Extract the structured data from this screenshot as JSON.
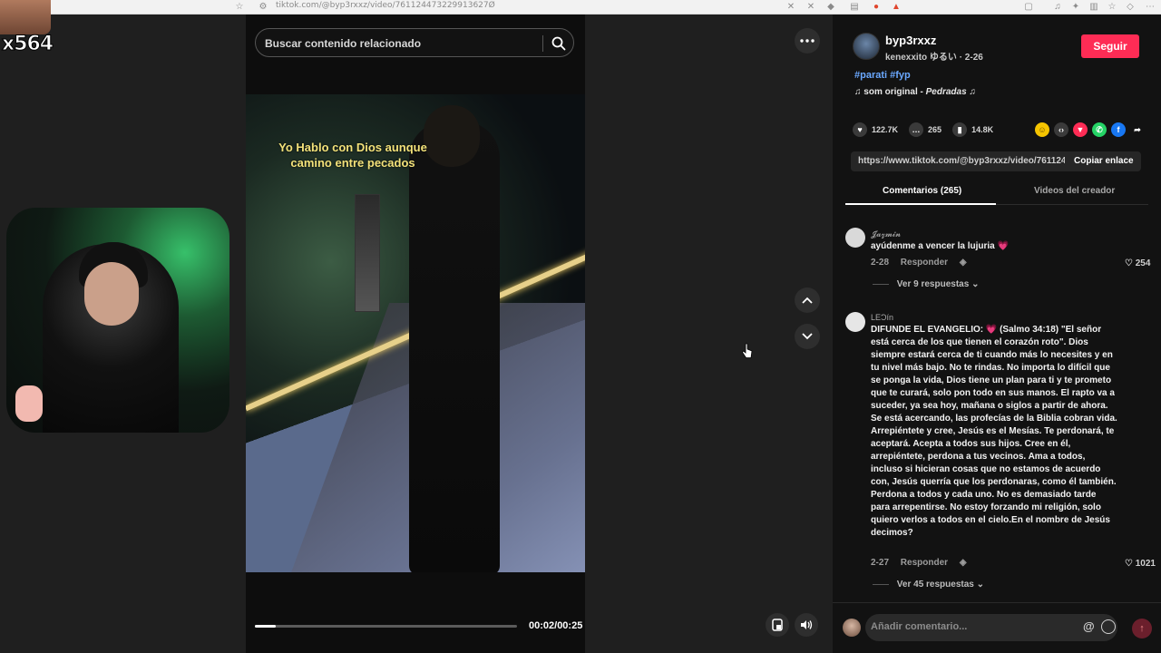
{
  "browser": {
    "url": "tiktok.com/@byp3rxxz/video/761124473229913627Ø"
  },
  "overlay": {
    "streamer_tag": "x564"
  },
  "video": {
    "search_placeholder": "Buscar contenido relacionado",
    "caption": "Yo Hablo con Dios aunque camino entre pecados",
    "time": "00:02/00:25",
    "progress": 0.08
  },
  "author": {
    "username": "byp3rxxz",
    "subtitle": "kenexxito ゆるい · 2-26",
    "follow_label": "Seguir",
    "hashtags": "#parati #fyp",
    "sound_prefix": "som original - ",
    "sound_name": "Pedradas"
  },
  "stats": {
    "likes": "122.7K",
    "comments": "265",
    "saves": "14.8K"
  },
  "share": {
    "link": "https://www.tiktok.com/@byp3rxxz/video/7611244...",
    "copy_label": "Copiar enlace"
  },
  "tabs": [
    {
      "label": "Comentarios (265)",
      "active": true
    },
    {
      "label": "Videos del creador",
      "active": false
    }
  ],
  "comments": [
    {
      "user": "𝓙𝓪𝔃𝓶𝓲𝓷",
      "text": "ayúdenme a vencer la lujuria 💗",
      "date": "2-28",
      "reply_label": "Responder",
      "likes": "254",
      "replies": "Ver 9 respuestas"
    },
    {
      "user": "LΕƆín",
      "text": "DIFUNDE EL EVANGELIO: 💗 (Salmo 34:18) \"El señor está cerca de los que tienen el corazón roto\". Dios siempre estará cerca de ti cuando más lo necesites y en tu nivel más bajo. No te rindas. No importa lo difícil que se ponga la vida, Dios tiene un plan para ti y te prometo que te curará, solo pon todo en sus manos. El rapto va a suceder, ya sea hoy, mañana o siglos a partir de ahora. Se está acercando, las profecías de la Biblia cobran vida. Arrepiéntete y cree, Jesús es el Mesías. Te perdonará, te aceptará. Acepta a todos sus hijos. Cree en él, arrepiéntete, perdona a tus vecinos. Ama a todos, incluso si hicieran cosas que no estamos de acuerdo con, Jesús querría que los perdonaras, como él también. Perdona a todos y cada uno. No es demasiado tarde para arrepentirse. No estoy forzando mi religión, solo quiero verlos a todos en el cielo.En el nombre de Jesús decimos?",
      "date": "2-27",
      "reply_label": "Responder",
      "likes": "1021",
      "replies": "Ver 45 respuestas"
    }
  ],
  "comment_input": {
    "placeholder": "Añadir comentario...",
    "at_symbol": "@"
  },
  "colors": {
    "follow": "#fe2c55",
    "hashtag": "#6aa8ff",
    "caption": "#f3e27a"
  }
}
